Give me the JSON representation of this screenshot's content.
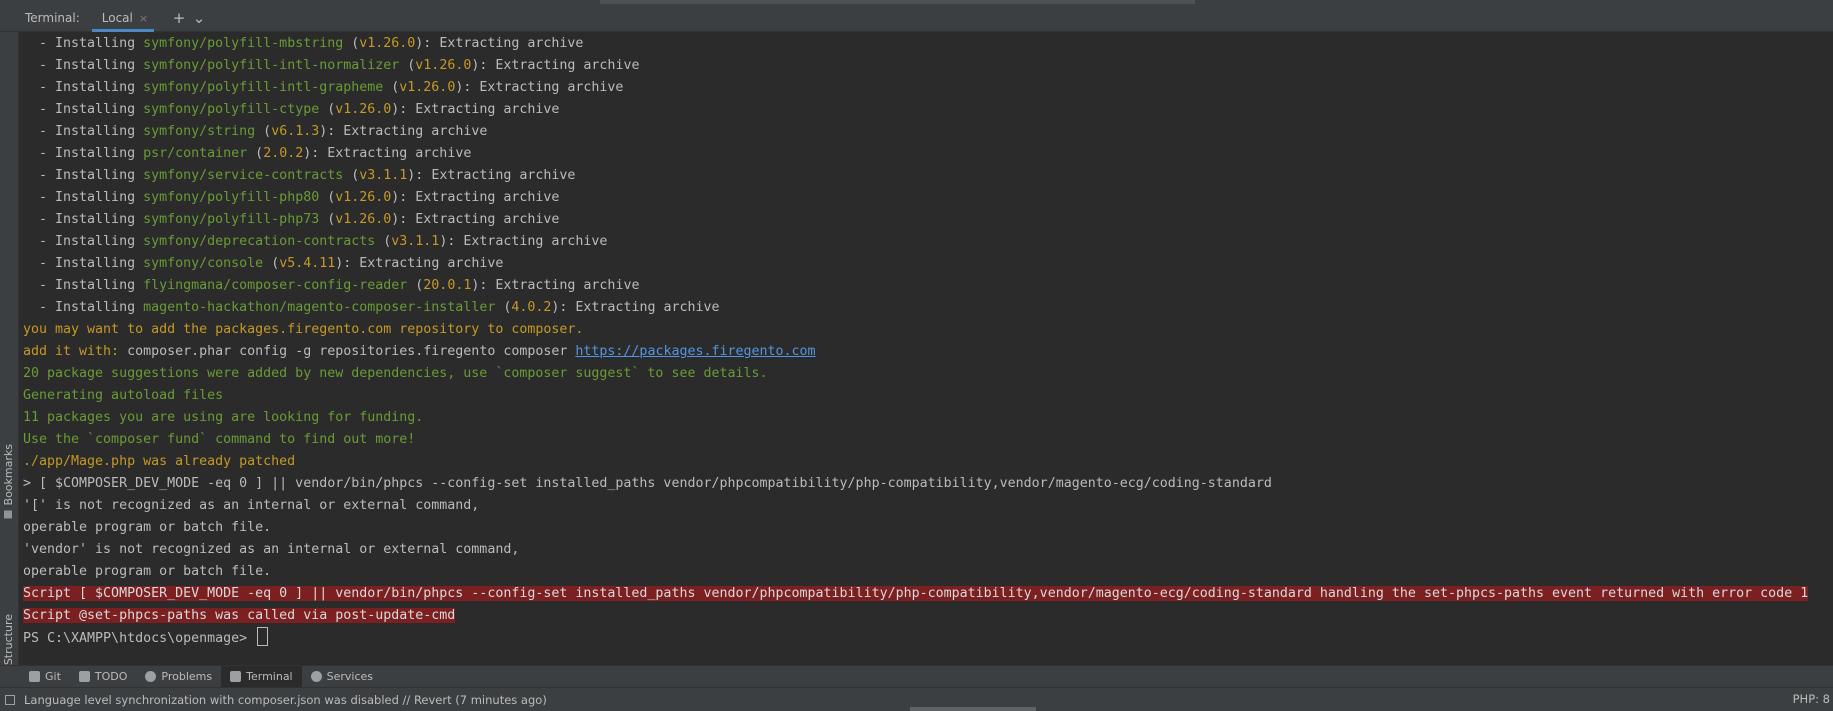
{
  "tabbar": {
    "label": "Terminal:",
    "tab_label": "Local",
    "close_glyph": "×",
    "add_glyph": "+",
    "menu_glyph": "⌄"
  },
  "left_tools": [
    {
      "label": "Bookmarks",
      "icon": "bookmark-icon"
    },
    {
      "label": "Structure",
      "icon": "structure-icon"
    }
  ],
  "terminal": {
    "installs": [
      {
        "prefix": "  - Installing ",
        "pkg": "symfony/polyfill-mbstring",
        "ver": "v1.26.0",
        "suffix": "): Extracting archive"
      },
      {
        "prefix": "  - Installing ",
        "pkg": "symfony/polyfill-intl-normalizer",
        "ver": "v1.26.0",
        "suffix": "): Extracting archive"
      },
      {
        "prefix": "  - Installing ",
        "pkg": "symfony/polyfill-intl-grapheme",
        "ver": "v1.26.0",
        "suffix": "): Extracting archive"
      },
      {
        "prefix": "  - Installing ",
        "pkg": "symfony/polyfill-ctype",
        "ver": "v1.26.0",
        "suffix": "): Extracting archive"
      },
      {
        "prefix": "  - Installing ",
        "pkg": "symfony/string",
        "ver": "v6.1.3",
        "suffix": "): Extracting archive"
      },
      {
        "prefix": "  - Installing ",
        "pkg": "psr/container",
        "ver": "2.0.2",
        "suffix": "): Extracting archive"
      },
      {
        "prefix": "  - Installing ",
        "pkg": "symfony/service-contracts",
        "ver": "v3.1.1",
        "suffix": "): Extracting archive"
      },
      {
        "prefix": "  - Installing ",
        "pkg": "symfony/polyfill-php80",
        "ver": "v1.26.0",
        "suffix": "): Extracting archive"
      },
      {
        "prefix": "  - Installing ",
        "pkg": "symfony/polyfill-php73",
        "ver": "v1.26.0",
        "suffix": "): Extracting archive"
      },
      {
        "prefix": "  - Installing ",
        "pkg": "symfony/deprecation-contracts",
        "ver": "v3.1.1",
        "suffix": "): Extracting archive"
      },
      {
        "prefix": "  - Installing ",
        "pkg": "symfony/console",
        "ver": "v5.4.11",
        "suffix": "): Extracting archive"
      },
      {
        "prefix": "  - Installing ",
        "pkg": "flyingmana/composer-config-reader",
        "ver": "20.0.1",
        "suffix": "): Extracting archive"
      },
      {
        "prefix": "  - Installing ",
        "pkg": "magento-hackathon/magento-composer-installer",
        "ver": "4.0.2",
        "suffix": "): Extracting archive"
      }
    ],
    "notice1": "you may want to add the packages.firegento.com repository to composer.",
    "add_prefix": "add it with: ",
    "add_cmd": "composer.phar config -g repositories.firegento composer ",
    "add_link": "https://packages.firegento.com",
    "suggestions": "20 package suggestions were added by new dependencies, use `composer suggest` to see details.",
    "autoload": "Generating autoload files",
    "funding": "11 packages you are using are looking for funding.",
    "fund_cmd": "Use the `composer fund` command to find out more!",
    "patched": "./app/Mage.php was already patched",
    "script_cmd": "> [ $COMPOSER_DEV_MODE -eq 0 ] || vendor/bin/phpcs --config-set installed_paths vendor/phpcompatibility/php-compatibility,vendor/magento-ecg/coding-standard",
    "err1": "'[' is not recognized as an internal or external command,",
    "err1b": "operable program or batch file.",
    "err2": "'vendor' is not recognized as an internal or external command,",
    "err2b": "operable program or batch file.",
    "script_error": "Script [ $COMPOSER_DEV_MODE -eq 0 ] || vendor/bin/phpcs --config-set installed_paths vendor/phpcompatibility/php-compatibility,vendor/magento-ecg/coding-standard handling the set-phpcs-paths event returned with error code 1",
    "script_called": "Script @set-phpcs-paths was called via post-update-cmd",
    "prompt": "PS C:\\XAMPP\\htdocs\\openmage> "
  },
  "toolwindows": [
    {
      "label": "Git",
      "icon": "git-icon"
    },
    {
      "label": "TODO",
      "icon": "todo-icon"
    },
    {
      "label": "Problems",
      "icon": "problems-icon"
    },
    {
      "label": "Terminal",
      "icon": "terminal-icon"
    },
    {
      "label": "Services",
      "icon": "services-icon"
    }
  ],
  "statusbar": {
    "message": "Language level synchronization with composer.json was disabled // Revert (7 minutes ago)",
    "right": "PHP: 8"
  },
  "colors": {
    "package": "#6a9b36",
    "version": "#c59925",
    "error_bg": "#7b1f21",
    "link": "#5395e0",
    "accent": "#4a88c7"
  }
}
